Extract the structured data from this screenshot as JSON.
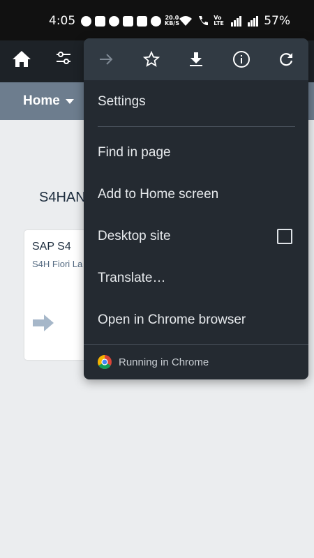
{
  "status_bar": {
    "time": "4:05",
    "speed_value": "20.0",
    "speed_unit": "KB/S",
    "volte": "Vo LTE",
    "battery": "57%"
  },
  "header": {
    "home_icon": "home-icon",
    "filter_icon": "sliders-icon"
  },
  "nav": {
    "home_label": "Home"
  },
  "content": {
    "group_title": "S4HAN",
    "tile": {
      "title": "SAP S4",
      "subtitle": "S4H Fiori La",
      "icon": "arrow-right-icon"
    }
  },
  "menu": {
    "toolbar": [
      "forward-icon",
      "star-icon",
      "download-icon",
      "info-icon",
      "refresh-icon"
    ],
    "items": {
      "settings": "Settings",
      "find_in_page": "Find in page",
      "add_to_home": "Add to Home screen",
      "desktop_site": "Desktop site",
      "translate": "Translate…",
      "open_in_chrome": "Open in Chrome browser"
    },
    "desktop_site_checked": false,
    "footer": "Running in Chrome"
  },
  "colors": {
    "status_bar": "#111111",
    "header": "#1d2227",
    "sub_bar": "#6d7d8e",
    "menu_bg": "#242a31",
    "menu_toolbar": "#313a43"
  }
}
